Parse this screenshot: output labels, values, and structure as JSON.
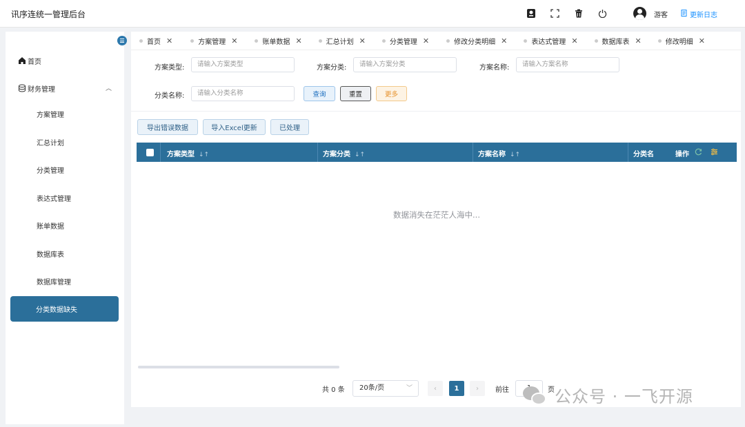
{
  "app": {
    "title": "讯序连统一管理后台"
  },
  "header": {
    "icons": [
      "badge-icon",
      "fullscreen-icon",
      "trash-icon",
      "power-icon"
    ],
    "user": {
      "name": "游客"
    },
    "changelog_label": "更新日志"
  },
  "sidebar": {
    "items": [
      {
        "label": "首页",
        "icon": "home-icon",
        "level": "top"
      },
      {
        "label": "财务管理",
        "icon": "database-icon",
        "level": "top",
        "expanded": true
      },
      {
        "label": "方案管理",
        "level": "sub"
      },
      {
        "label": "汇总计划",
        "level": "sub"
      },
      {
        "label": "分类管理",
        "level": "sub"
      },
      {
        "label": "表达式管理",
        "level": "sub"
      },
      {
        "label": "账单数据",
        "level": "sub"
      },
      {
        "label": "数据库表",
        "level": "sub"
      },
      {
        "label": "数据库管理",
        "level": "sub"
      },
      {
        "label": "分类数据缺失",
        "level": "sub",
        "active": true
      }
    ]
  },
  "tabs": [
    {
      "label": "首页"
    },
    {
      "label": "方案管理"
    },
    {
      "label": "账单数据"
    },
    {
      "label": "汇总计划"
    },
    {
      "label": "分类管理"
    },
    {
      "label": "修改分类明细"
    },
    {
      "label": "表达式管理"
    },
    {
      "label": "数据库表"
    },
    {
      "label": "修改明细"
    }
  ],
  "filters": {
    "scheme_type": {
      "label": "方案类型:",
      "placeholder": "请输入方案类型"
    },
    "scheme_category": {
      "label": "方案分类:",
      "placeholder": "请输入方案分类"
    },
    "scheme_name": {
      "label": "方案名称:",
      "placeholder": "请输入方案名称"
    },
    "category_name": {
      "label": "分类名称:",
      "placeholder": "请输入分类名称"
    },
    "query_label": "查询",
    "reset_label": "重置",
    "more_label": "更多"
  },
  "actions": {
    "export_errors": "导出错误数据",
    "import_excel": "导入Excel更新",
    "processed": "已处理"
  },
  "table": {
    "columns": [
      {
        "label": "方案类型",
        "sort": "↓↑"
      },
      {
        "label": "方案分类",
        "sort": "↓↑"
      },
      {
        "label": "方案名称",
        "sort": "↓↑"
      },
      {
        "label": "分类名"
      }
    ],
    "ops_label": "操作",
    "empty_text": "数据消失在茫茫人海中..."
  },
  "pagination": {
    "total": "共 0 条",
    "page_size": "20条/页",
    "current_page": "1",
    "goto_label": "前往",
    "goto_value": "1",
    "page_suffix": "页"
  },
  "watermark": {
    "text": "公众号 · 一飞开源"
  },
  "colors": {
    "primary": "#2b6f9a",
    "link": "#1890ff",
    "warning": "#e6912b"
  }
}
